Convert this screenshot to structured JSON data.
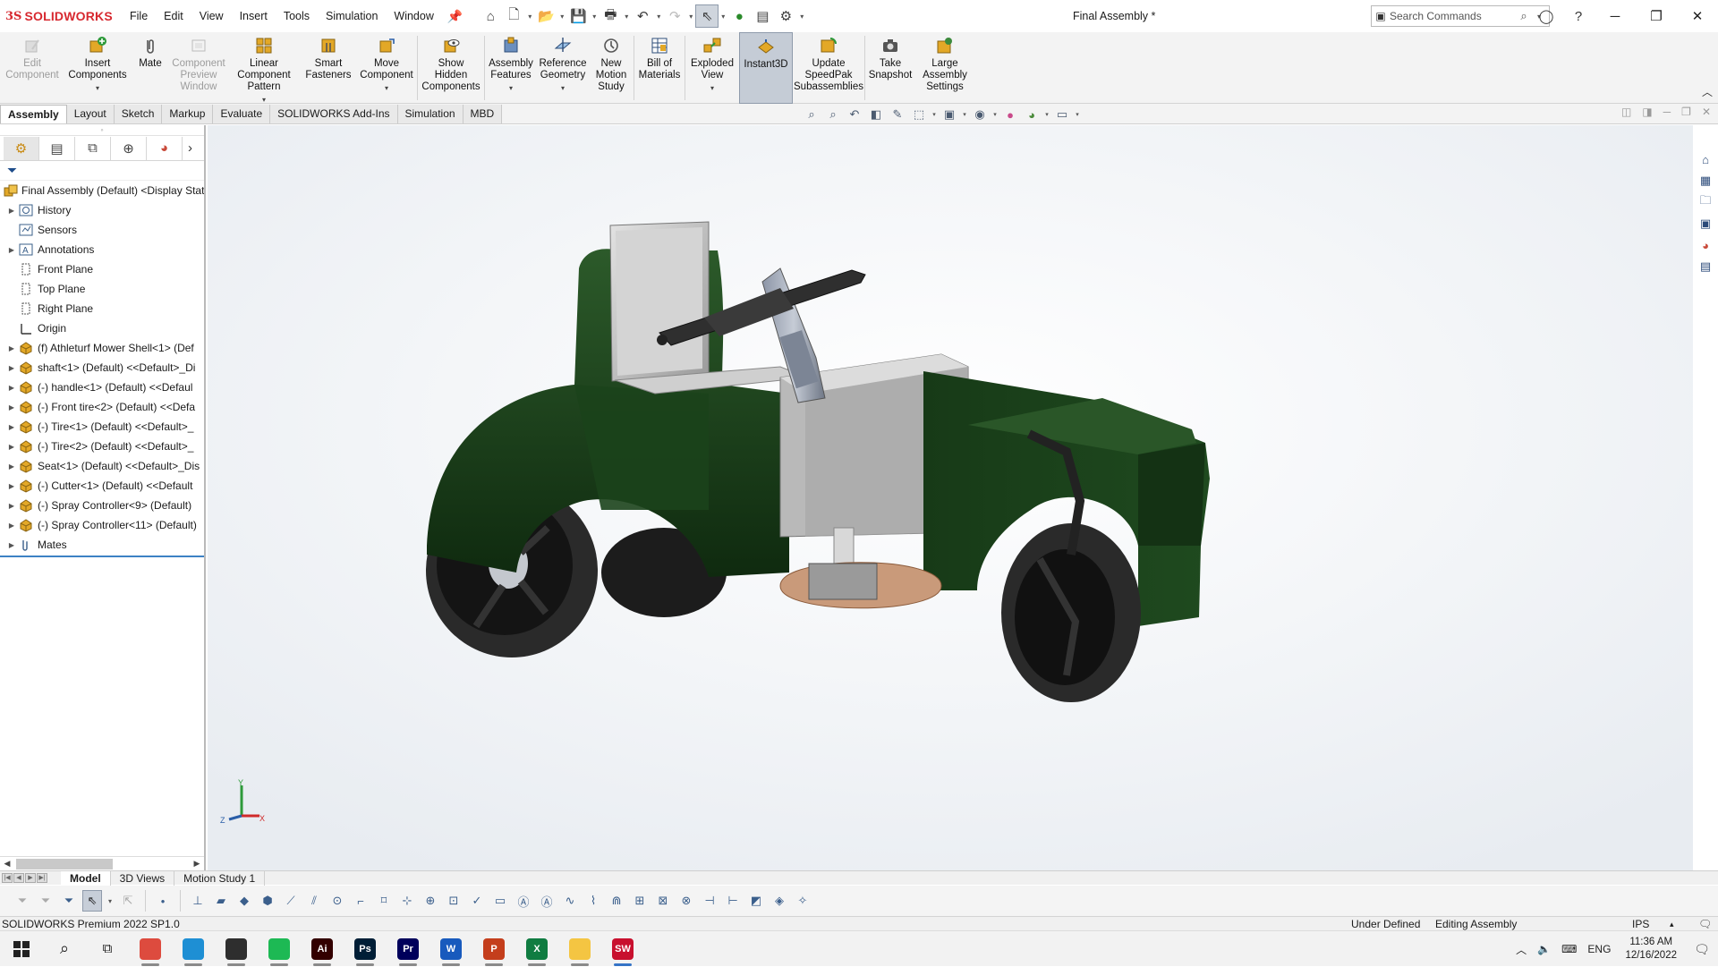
{
  "titlebar": {
    "logo_ds": "3S",
    "logo_text": "SOLIDWORKS",
    "menus": [
      "File",
      "Edit",
      "View",
      "Insert",
      "Tools",
      "Simulation",
      "Window"
    ],
    "document_title": "Final Assembly *",
    "search_placeholder": "Search Commands"
  },
  "command_manager": {
    "commands": [
      {
        "label": "Edit Component",
        "disabled": true
      },
      {
        "label": "Insert Components",
        "disabled": false
      },
      {
        "label": "Mate",
        "disabled": false
      },
      {
        "label": "Component Preview Window",
        "disabled": true
      },
      {
        "label": "Linear Component Pattern",
        "disabled": false
      },
      {
        "label": "Smart Fasteners",
        "disabled": false
      },
      {
        "label": "Move Component",
        "disabled": false
      },
      {
        "label": "Show Hidden Components",
        "disabled": false
      },
      {
        "label": "Assembly Features",
        "disabled": false
      },
      {
        "label": "Reference Geometry",
        "disabled": false
      },
      {
        "label": "New Motion Study",
        "disabled": false
      },
      {
        "label": "Bill of Materials",
        "disabled": false
      },
      {
        "label": "Exploded View",
        "disabled": false
      },
      {
        "label": "Instant3D",
        "disabled": false,
        "selected": true
      },
      {
        "label": "Update SpeedPak Subassemblies",
        "disabled": false
      },
      {
        "label": "Take Snapshot",
        "disabled": false
      },
      {
        "label": "Large Assembly Settings",
        "disabled": false
      }
    ],
    "tabs": [
      "Assembly",
      "Layout",
      "Sketch",
      "Markup",
      "Evaluate",
      "SOLIDWORKS Add-Ins",
      "Simulation",
      "MBD"
    ],
    "active_tab": "Assembly"
  },
  "feature_tree": {
    "root": "Final Assembly (Default) <Display Stat",
    "items": [
      {
        "label": "History",
        "expandable": true,
        "icon": "history-icon"
      },
      {
        "label": "Sensors",
        "expandable": false,
        "icon": "sensors-icon"
      },
      {
        "label": "Annotations",
        "expandable": true,
        "icon": "annotations-icon"
      },
      {
        "label": "Front Plane",
        "expandable": false,
        "icon": "plane-icon"
      },
      {
        "label": "Top Plane",
        "expandable": false,
        "icon": "plane-icon"
      },
      {
        "label": "Right Plane",
        "expandable": false,
        "icon": "plane-icon"
      },
      {
        "label": "Origin",
        "expandable": false,
        "icon": "origin-icon"
      },
      {
        "label": "(f) Athleturf Mower Shell<1> (Def",
        "expandable": true,
        "icon": "part-icon"
      },
      {
        "label": "shaft<1> (Default) <<Default>_Di",
        "expandable": true,
        "icon": "part-icon"
      },
      {
        "label": "(-) handle<1> (Default) <<Defaul",
        "expandable": true,
        "icon": "part-icon"
      },
      {
        "label": "(-) Front tire<2> (Default) <<Defa",
        "expandable": true,
        "icon": "part-icon"
      },
      {
        "label": "(-) Tire<1> (Default) <<Default>_",
        "expandable": true,
        "icon": "part-icon"
      },
      {
        "label": "(-) Tire<2> (Default) <<Default>_",
        "expandable": true,
        "icon": "part-icon"
      },
      {
        "label": "Seat<1> (Default) <<Default>_Dis",
        "expandable": true,
        "icon": "part-icon"
      },
      {
        "label": "(-) Cutter<1> (Default) <<Default",
        "expandable": true,
        "icon": "part-icon"
      },
      {
        "label": "(-) Spray Controller<9> (Default)",
        "expandable": true,
        "icon": "part-icon"
      },
      {
        "label": "(-) Spray Controller<11> (Default)",
        "expandable": true,
        "icon": "part-icon"
      },
      {
        "label": "Mates",
        "expandable": true,
        "icon": "mates-icon"
      }
    ]
  },
  "bottom_tabs": [
    "Model",
    "3D Views",
    "Motion Study 1"
  ],
  "active_bottom_tab": "Model",
  "statusbar": {
    "product": "SOLIDWORKS Premium 2022 SP1.0",
    "definition": "Under Defined",
    "mode": "Editing Assembly",
    "units": "IPS"
  },
  "taskbar": {
    "apps": [
      {
        "name": "Chrome",
        "abbr": "",
        "color": "#dd4b3e",
        "active": false
      },
      {
        "name": "Edge",
        "abbr": "",
        "color": "#1e8fd4",
        "active": false
      },
      {
        "name": "Sticky Notes",
        "abbr": "",
        "color": "#2e2e2e",
        "active": false
      },
      {
        "name": "Spotify",
        "abbr": "",
        "color": "#1db954",
        "active": false
      },
      {
        "name": "Illustrator",
        "abbr": "Ai",
        "color": "#330000",
        "active": false
      },
      {
        "name": "Photoshop",
        "abbr": "Ps",
        "color": "#001e36",
        "active": false
      },
      {
        "name": "Premiere",
        "abbr": "Pr",
        "color": "#00005b",
        "active": false
      },
      {
        "name": "Word",
        "abbr": "W",
        "color": "#185abd",
        "active": false
      },
      {
        "name": "PowerPoint",
        "abbr": "P",
        "color": "#c43e1c",
        "active": false
      },
      {
        "name": "Excel",
        "abbr": "X",
        "color": "#107c41",
        "active": false
      },
      {
        "name": "File Explorer",
        "abbr": "",
        "color": "#f4c542",
        "active": false
      },
      {
        "name": "SOLIDWORKS",
        "abbr": "SW",
        "color": "#c8102e",
        "active": true
      }
    ],
    "language": "ENG",
    "time": "11:36 AM",
    "date": "12/16/2022"
  },
  "colors": {
    "brand": "#d7282f",
    "body_green": "#173a17",
    "selection_blue": "#3d82c4"
  }
}
